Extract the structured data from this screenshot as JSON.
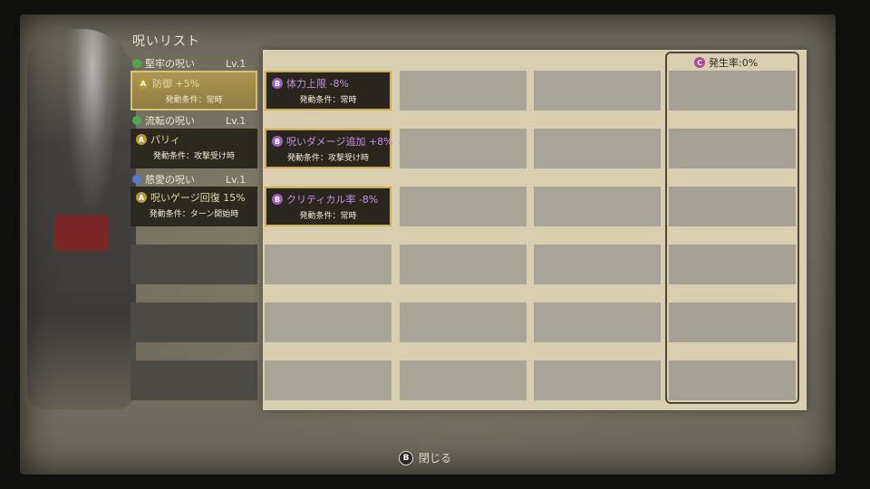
{
  "panel": {
    "title": "呪いリスト"
  },
  "rate": {
    "badge": "C",
    "label": "発生率:0%"
  },
  "left_groups": [
    {
      "name": "堅牢の呪い",
      "level": "Lv.1",
      "badge_color": "#4fa84c",
      "skill": {
        "badge": "A",
        "title": "防御 +5%",
        "condition": "発動条件：常時",
        "selected": true
      }
    },
    {
      "name": "流転の呪い",
      "level": "Lv.1",
      "badge_color": "#4fa84c",
      "skill": {
        "badge": "A",
        "title": "パリィ",
        "condition": "発動条件：攻撃受け時",
        "selected": false
      }
    },
    {
      "name": "慈愛の呪い",
      "level": "Lv.1",
      "badge_color": "#4f7bc8",
      "skill": {
        "badge": "A",
        "title": "呪いゲージ回復 15%",
        "condition": "発動条件：ターン開始時",
        "selected": false
      }
    }
  ],
  "curse_cells": [
    {
      "badge": "B",
      "title": "体力上限 -8%",
      "condition": "発動条件：常時"
    },
    {
      "badge": "B",
      "title": "呪いダメージ追加 +8%",
      "condition": "発動条件：攻撃受け時"
    },
    {
      "badge": "B",
      "title": "クリティカル率 -8%",
      "condition": "発動条件：常時"
    }
  ],
  "footer": {
    "button_glyph": "B",
    "close_label": "閉じる"
  },
  "colors": {
    "gold_border": "#c9ac5a",
    "curse_text": "#c48ee8",
    "parchment": "#d8cfb1"
  }
}
